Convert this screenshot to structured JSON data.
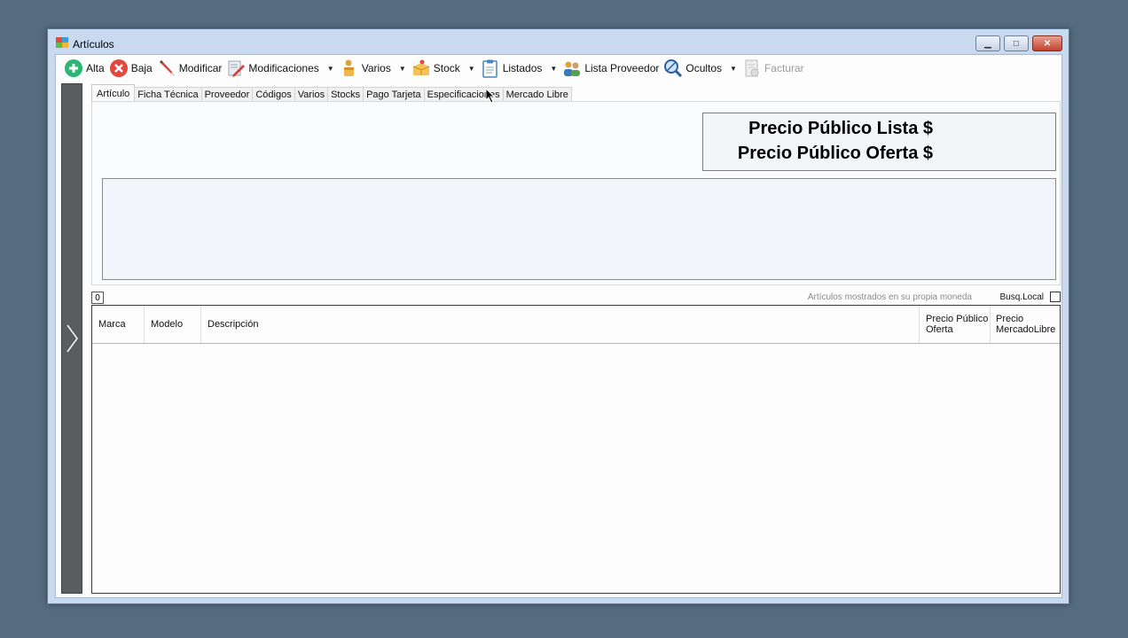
{
  "window": {
    "title": "Artículos"
  },
  "toolbar": {
    "items": [
      {
        "label": "Alta",
        "icon": "add-circle-icon",
        "color": "#2bb673"
      },
      {
        "label": "Baja",
        "icon": "delete-circle-icon",
        "color": "#e2483d"
      },
      {
        "label": "Modificar",
        "icon": "pencil-icon",
        "color": "#d9443a"
      },
      {
        "label": "Modificaciones",
        "icon": "edit-document-icon",
        "dropdown": true
      },
      {
        "label": "Varios",
        "icon": "misc-items-icon",
        "dropdown": true
      },
      {
        "label": "Stock",
        "icon": "box-icon",
        "dropdown": true
      },
      {
        "label": "Listados",
        "icon": "clipboard-icon",
        "dropdown": true
      },
      {
        "label": "Lista Proveedor",
        "icon": "users-icon"
      },
      {
        "label": "Ocultos",
        "icon": "hidden-search-icon",
        "dropdown": true
      },
      {
        "label": "Facturar",
        "icon": "invoice-icon",
        "disabled": true
      }
    ]
  },
  "tabs": [
    "Artículo",
    "Ficha Técnica",
    "Proveedor",
    "Códigos",
    "Varios",
    "Stocks",
    "Pago Tarjeta",
    "Especificaciones",
    "Mercado Libre"
  ],
  "price_panel": {
    "lista_label": "Precio Público Lista $",
    "oferta_label": "Precio Público Oferta $"
  },
  "status": {
    "count": "0",
    "note": "Artículos mostrados en su propia moneda",
    "busq_label": "Busq.Local"
  },
  "grid": {
    "columns": [
      "Marca",
      "Modelo",
      "Descripción",
      "Precio Público Oferta",
      "Precio MercadoLibre"
    ]
  }
}
